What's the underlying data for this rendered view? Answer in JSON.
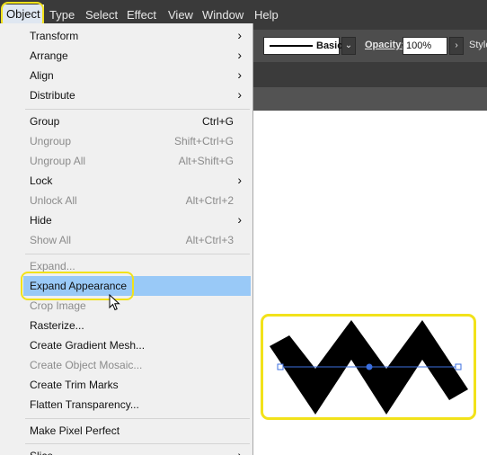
{
  "menubar": {
    "items": [
      {
        "label": "Object"
      },
      {
        "label": "Type"
      },
      {
        "label": "Select"
      },
      {
        "label": "Effect"
      },
      {
        "label": "View"
      },
      {
        "label": "Window"
      },
      {
        "label": "Help"
      }
    ]
  },
  "controlbar": {
    "stroke_style": "Basic",
    "opacity_label": "Opacity:",
    "opacity_value": "100%",
    "styles_label": "Style"
  },
  "menu": {
    "items": [
      {
        "label": "Transform",
        "shortcut": "",
        "submenu": true,
        "disabled": false
      },
      {
        "label": "Arrange",
        "shortcut": "",
        "submenu": true,
        "disabled": false
      },
      {
        "label": "Align",
        "shortcut": "",
        "submenu": true,
        "disabled": false
      },
      {
        "label": "Distribute",
        "shortcut": "",
        "submenu": true,
        "disabled": false
      },
      {
        "label": "Group",
        "shortcut": "Ctrl+G",
        "submenu": false,
        "disabled": false
      },
      {
        "label": "Ungroup",
        "shortcut": "Shift+Ctrl+G",
        "submenu": false,
        "disabled": true
      },
      {
        "label": "Ungroup All",
        "shortcut": "Alt+Shift+G",
        "submenu": false,
        "disabled": true
      },
      {
        "label": "Lock",
        "shortcut": "",
        "submenu": true,
        "disabled": false
      },
      {
        "label": "Unlock All",
        "shortcut": "Alt+Ctrl+2",
        "submenu": false,
        "disabled": true
      },
      {
        "label": "Hide",
        "shortcut": "",
        "submenu": true,
        "disabled": false
      },
      {
        "label": "Show All",
        "shortcut": "Alt+Ctrl+3",
        "submenu": false,
        "disabled": true
      },
      {
        "label": "Expand...",
        "shortcut": "",
        "submenu": false,
        "disabled": true
      },
      {
        "label": "Expand Appearance",
        "shortcut": "",
        "submenu": false,
        "disabled": false,
        "selected": true
      },
      {
        "label": "Crop Image",
        "shortcut": "",
        "submenu": false,
        "disabled": true
      },
      {
        "label": "Rasterize...",
        "shortcut": "",
        "submenu": false,
        "disabled": false
      },
      {
        "label": "Create Gradient Mesh...",
        "shortcut": "",
        "submenu": false,
        "disabled": false
      },
      {
        "label": "Create Object Mosaic...",
        "shortcut": "",
        "submenu": false,
        "disabled": true
      },
      {
        "label": "Create Trim Marks",
        "shortcut": "",
        "submenu": false,
        "disabled": false
      },
      {
        "label": "Flatten Transparency...",
        "shortcut": "",
        "submenu": false,
        "disabled": false
      },
      {
        "label": "Make Pixel Perfect",
        "shortcut": "",
        "submenu": false,
        "disabled": false
      },
      {
        "label": "Slice",
        "shortcut": "",
        "submenu": true,
        "disabled": false
      }
    ]
  },
  "colors": {
    "highlight": "#f2e21a",
    "selection": "#99c9f7",
    "path_guide": "#3b6fe0"
  },
  "icons": {
    "submenu": "chevron-right-icon",
    "cursor": "mouse-pointer-icon"
  }
}
